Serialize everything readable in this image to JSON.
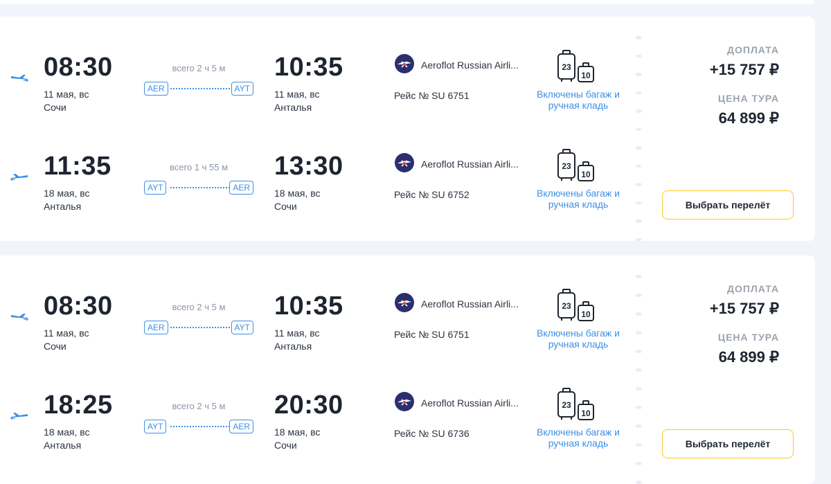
{
  "offers": [
    {
      "legs": [
        {
          "direction": "outbound",
          "dep_time": "08:30",
          "dep_date": "11 мая, вс",
          "dep_city": "Сочи",
          "duration": "всего 2 ч 5 м",
          "from_code": "AER",
          "to_code": "AYT",
          "arr_time": "10:35",
          "arr_date": "11 мая, вс",
          "arr_city": "Анталья",
          "airline": "Aeroflot Russian Airli...",
          "flight": "Рейс № SU 6751",
          "baggage": "Включены багаж и ручная кладь",
          "bag_weight": "23",
          "hand_weight": "10"
        },
        {
          "direction": "return",
          "dep_time": "11:35",
          "dep_date": "18 мая, вс",
          "dep_city": "Анталья",
          "duration": "всего 1 ч 55 м",
          "from_code": "AYT",
          "to_code": "AER",
          "arr_time": "13:30",
          "arr_date": "18 мая, вс",
          "arr_city": "Сочи",
          "airline": "Aeroflot Russian Airli...",
          "flight": "Рейс № SU 6752",
          "baggage": "Включены багаж и ручная кладь",
          "bag_weight": "23",
          "hand_weight": "10"
        }
      ],
      "surcharge_label": "ДОПЛАТА",
      "surcharge": "+15 757 ₽",
      "tour_label": "ЦЕНА ТУРА",
      "tour_price": "64 899 ₽",
      "button": "Выбрать перелёт"
    },
    {
      "legs": [
        {
          "direction": "outbound",
          "dep_time": "08:30",
          "dep_date": "11 мая, вс",
          "dep_city": "Сочи",
          "duration": "всего 2 ч 5 м",
          "from_code": "AER",
          "to_code": "AYT",
          "arr_time": "10:35",
          "arr_date": "11 мая, вс",
          "arr_city": "Анталья",
          "airline": "Aeroflot Russian Airli...",
          "flight": "Рейс № SU 6751",
          "baggage": "Включены багаж и ручная кладь",
          "bag_weight": "23",
          "hand_weight": "10"
        },
        {
          "direction": "return",
          "dep_time": "18:25",
          "dep_date": "18 мая, вс",
          "dep_city": "Анталья",
          "duration": "всего 2 ч 5 м",
          "from_code": "AYT",
          "to_code": "AER",
          "arr_time": "20:30",
          "arr_date": "18 мая, вс",
          "arr_city": "Сочи",
          "airline": "Aeroflot Russian Airli...",
          "flight": "Рейс № SU 6736",
          "baggage": "Включены багаж и ручная кладь",
          "bag_weight": "23",
          "hand_weight": "10"
        }
      ],
      "surcharge_label": "ДОПЛАТА",
      "surcharge": "+15 757 ₽",
      "tour_label": "ЦЕНА ТУРА",
      "tour_price": "64 899 ₽",
      "button": "Выбрать перелёт"
    }
  ],
  "colors": {
    "accent": "#3b8fe6",
    "button_border": "#f7c922",
    "airline_logo": "#2b2f6e"
  },
  "icons": {
    "outbound": "plane-takeoff-icon",
    "return": "plane-landing-icon",
    "airline": "aeroflot-logo-icon",
    "baggage": "luggage-icon"
  }
}
